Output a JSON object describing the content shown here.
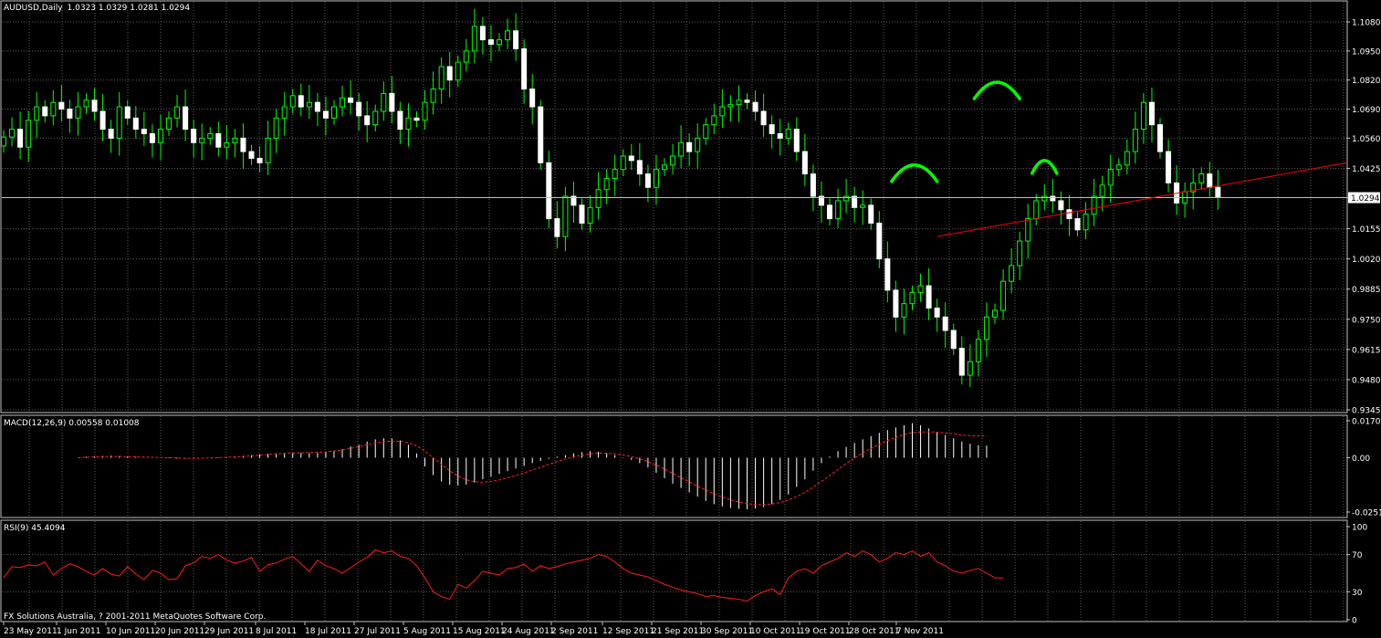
{
  "app": {
    "symbol_title": "AUDUSD,Daily",
    "ohlc_readout": "1.0323 1.0329 1.0281 1.0294",
    "footer_text": "FX Solutions Australia, ? 2001-2011 MetaQuotes Software Corp."
  },
  "colors": {
    "background": "#000000",
    "grid": "#5b5b5b",
    "frame": "#c0c0c0",
    "candle_up_body": "#000000",
    "candle_up_outline": "#00ff00",
    "candle_down_body": "#ffffff",
    "wick": "#00ff00",
    "macd_hist": "#ffffff",
    "macd_signal": "#ff2020",
    "rsi_line": "#ff1a1a",
    "trendline": "#ff0000",
    "annotation": "#00ff00",
    "current_price_line": "#c0c0c0"
  },
  "chart_data": [
    {
      "type": "candlestick",
      "title": "AUDUSD,Daily",
      "ylim": [
        0.9345,
        1.113
      ],
      "yticks": [
        "1.1080",
        "1.0950",
        "1.0820",
        "1.0690",
        "1.0560",
        "1.0425",
        "1.0294",
        "1.0155",
        "1.0020",
        "0.9885",
        "0.9750",
        "0.9615",
        "0.9480",
        "0.9345"
      ],
      "current_price": "1.0294",
      "xticks": [
        "23 May 2011",
        "1 Jun 2011",
        "10 Jun 2011",
        "20 Jun 2011",
        "29 Jun 2011",
        "8 Jul 2011",
        "18 Jul 2011",
        "27 Jul 2011",
        "5 Aug 2011",
        "15 Aug 2011",
        "24 Aug 2011",
        "2 Sep 2011",
        "12 Sep 2011",
        "21 Sep 2011",
        "30 Sep 2011",
        "10 Oct 2011",
        "19 Oct 2011",
        "28 Oct 2011",
        "7 Nov 2011"
      ],
      "closes": [
        1.0565,
        1.06,
        1.052,
        1.064,
        1.07,
        1.066,
        1.072,
        1.069,
        1.065,
        1.07,
        1.073,
        1.068,
        1.06,
        1.056,
        1.07,
        1.065,
        1.06,
        1.058,
        1.054,
        1.06,
        1.065,
        1.07,
        1.06,
        1.054,
        1.056,
        1.058,
        1.052,
        1.054,
        1.056,
        1.05,
        1.047,
        1.045,
        1.056,
        1.065,
        1.07,
        1.075,
        1.07,
        1.072,
        1.068,
        1.065,
        1.07,
        1.074,
        1.072,
        1.066,
        1.062,
        1.068,
        1.076,
        1.068,
        1.06,
        1.065,
        1.064,
        1.072,
        1.078,
        1.088,
        1.082,
        1.09,
        1.095,
        1.106,
        1.1,
        1.098,
        1.1,
        1.104,
        1.096,
        1.078,
        1.07,
        1.045,
        1.02,
        1.012,
        1.03,
        1.026,
        1.018,
        1.025,
        1.033,
        1.038,
        1.042,
        1.048,
        1.046,
        1.04,
        1.034,
        1.042,
        1.044,
        1.048,
        1.054,
        1.05,
        1.056,
        1.062,
        1.066,
        1.07,
        1.071,
        1.073,
        1.072,
        1.068,
        1.062,
        1.058,
        1.056,
        1.06,
        1.05,
        1.04,
        1.03,
        1.026,
        1.02,
        1.028,
        1.03,
        1.025,
        1.026,
        1.018,
        1.002,
        0.988,
        0.976,
        0.982,
        0.987,
        0.99,
        0.98,
        0.976,
        0.97,
        0.962,
        0.95,
        0.956,
        0.966,
        0.976,
        0.979,
        0.992,
        0.999,
        1.01,
        1.02,
        1.028,
        1.03,
        1.028,
        1.024,
        1.02,
        1.015,
        1.022,
        1.03,
        1.035,
        1.042,
        1.044,
        1.05,
        1.06,
        1.072,
        1.062,
        1.05,
        1.036,
        1.027,
        1.032,
        1.036,
        1.04,
        1.034,
        1.0294
      ],
      "annotations": [
        "left-shoulder-arc",
        "head-arc",
        "right-shoulder-arc",
        "neckline"
      ]
    },
    {
      "type": "histogram+line",
      "title": "MACD(12,26,9) 0.00558 0.01008",
      "yticks": [
        "0.01709",
        "0.00",
        "-0.02512"
      ],
      "ylim": [
        -0.027,
        0.018
      ],
      "hist_from_index": 9,
      "hist": [
        0.0,
        0.0004,
        0.0006,
        0.0008,
        0.001,
        0.0008,
        0.0006,
        0.0004,
        0.0002,
        0.0001,
        0.0,
        -0.0002,
        -0.0004,
        -0.0005,
        -0.0004,
        -0.0002,
        0.0,
        0.0002,
        0.0004,
        0.0006,
        0.0009,
        0.0012,
        0.0015,
        0.0018,
        0.002,
        0.0021,
        0.0022,
        0.0022,
        0.0021,
        0.0022,
        0.0025,
        0.0032,
        0.004,
        0.0052,
        0.006,
        0.0075,
        0.0085,
        0.009,
        0.0089,
        0.008,
        0.006,
        0.002,
        -0.004,
        -0.008,
        -0.011,
        -0.0125,
        -0.0128,
        -0.0125,
        -0.0115,
        -0.01,
        -0.0088,
        -0.0075,
        -0.0062,
        -0.005,
        -0.0038,
        -0.0025,
        -0.0015,
        -0.0005,
        0.0005,
        0.0012,
        0.002,
        0.0026,
        0.003,
        0.0028,
        0.0022,
        0.0012,
        0.0002,
        -0.001,
        -0.0025,
        -0.0045,
        -0.007,
        -0.0095,
        -0.012,
        -0.014,
        -0.016,
        -0.018,
        -0.02,
        -0.0215,
        -0.0225,
        -0.0232,
        -0.0236,
        -0.0238,
        -0.0235,
        -0.0228,
        -0.0215,
        -0.0195,
        -0.017,
        -0.0135,
        -0.01,
        -0.006,
        -0.0025,
        0.0005,
        0.003,
        0.005,
        0.0068,
        0.0085,
        0.01,
        0.0115,
        0.0128,
        0.014,
        0.015,
        0.016,
        0.015,
        0.0135,
        0.012,
        0.0105,
        0.009,
        0.0075,
        0.0065,
        0.0058,
        0.0056
      ],
      "signal": [
        0.0,
        0.0002,
        0.0004,
        0.0005,
        0.0006,
        0.0006,
        0.0005,
        0.0004,
        0.0003,
        0.0002,
        0.0001,
        0.0,
        -0.0001,
        -0.0002,
        -0.0003,
        -0.0002,
        -0.0001,
        0.0,
        0.0002,
        0.0004,
        0.0006,
        0.0009,
        0.0012,
        0.0015,
        0.0018,
        0.002,
        0.0022,
        0.0023,
        0.0024,
        0.0025,
        0.0027,
        0.0031,
        0.0036,
        0.0043,
        0.0051,
        0.006,
        0.0068,
        0.0074,
        0.0077,
        0.0076,
        0.007,
        0.0055,
        0.003,
        0.0,
        -0.003,
        -0.006,
        -0.0085,
        -0.0102,
        -0.0111,
        -0.0113,
        -0.011,
        -0.0103,
        -0.0093,
        -0.0082,
        -0.007,
        -0.0057,
        -0.0044,
        -0.0031,
        -0.0018,
        -0.0006,
        0.0004,
        0.0012,
        0.0018,
        0.0021,
        0.0021,
        0.0018,
        0.0013,
        0.0005,
        -0.0005,
        -0.0018,
        -0.0034,
        -0.0052,
        -0.0072,
        -0.0092,
        -0.0112,
        -0.0132,
        -0.015,
        -0.0167,
        -0.0182,
        -0.0195,
        -0.0205,
        -0.0212,
        -0.0216,
        -0.0217,
        -0.0214,
        -0.0207,
        -0.0196,
        -0.018,
        -0.016,
        -0.0136,
        -0.011,
        -0.0082,
        -0.0054,
        -0.0027,
        -0.0002,
        0.0022,
        0.0043,
        0.0062,
        0.0079,
        0.0094,
        0.0107,
        0.0116,
        0.0119,
        0.012,
        0.0118,
        0.0115,
        0.011,
        0.0105,
        0.0102,
        0.0101,
        0.0101
      ]
    },
    {
      "type": "line",
      "title": "RSI(9) 45.4094",
      "ylim": [
        0,
        100
      ],
      "yticks": [
        "100",
        "70",
        "30",
        "0"
      ],
      "values": [
        45,
        57,
        56,
        59,
        58,
        62,
        48,
        55,
        60,
        57,
        52,
        48,
        55,
        49,
        47,
        57,
        49,
        43,
        53,
        50,
        43,
        44,
        58,
        61,
        68,
        66,
        70,
        64,
        61,
        63,
        67,
        52,
        59,
        61,
        65,
        68,
        60,
        52,
        64,
        58,
        55,
        50,
        56,
        62,
        67,
        75,
        72,
        74,
        68,
        66,
        58,
        45,
        30,
        25,
        22,
        38,
        34,
        42,
        52,
        50,
        48,
        55,
        56,
        60,
        52,
        58,
        55,
        57,
        60,
        62,
        64,
        66,
        70,
        68,
        62,
        55,
        50,
        48,
        46,
        42,
        38,
        35,
        32,
        30,
        28,
        25,
        26,
        24,
        23,
        22,
        20,
        26,
        30,
        33,
        27,
        45,
        52,
        55,
        50,
        58,
        62,
        66,
        72,
        68,
        74,
        70,
        62,
        66,
        72,
        70,
        74,
        68,
        72,
        62,
        58,
        52,
        50,
        53,
        55,
        50,
        45,
        45
      ]
    }
  ]
}
